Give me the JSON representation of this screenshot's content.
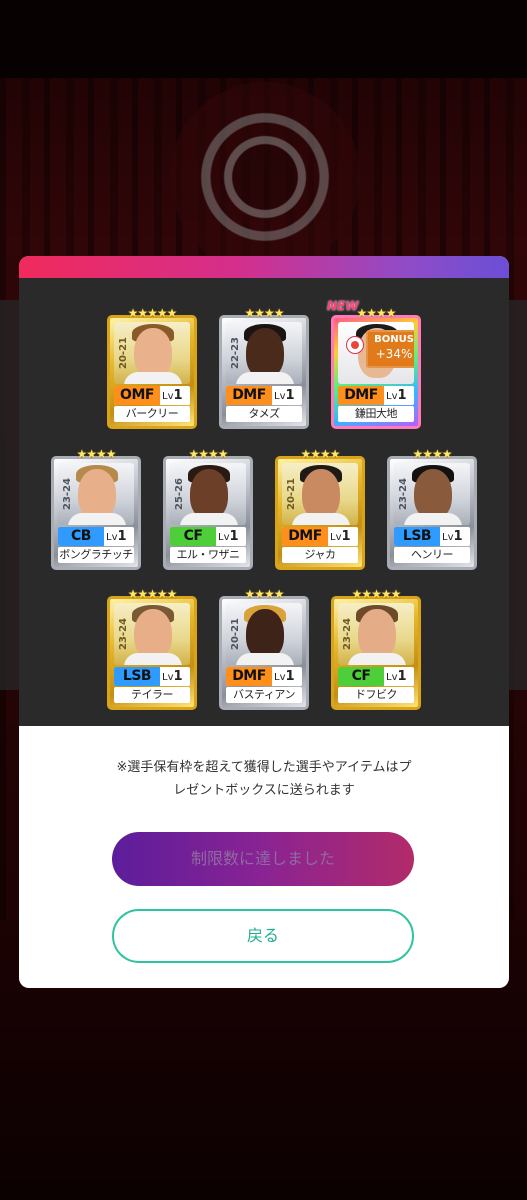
{
  "cards": [
    {
      "position": "OMF",
      "level_prefix": "Lv",
      "level": "1",
      "name": "バークリー",
      "season": "20-21",
      "stars": "★★★★★",
      "new": false
    },
    {
      "position": "DMF",
      "level_prefix": "Lv",
      "level": "1",
      "name": "タメズ",
      "season": "22-23",
      "stars": "★★★★",
      "new": false
    },
    {
      "position": "DMF",
      "level_prefix": "Lv",
      "level": "1",
      "name": "鎌田大地",
      "season": "",
      "stars": "★★★★",
      "new": true,
      "new_label": "NEW",
      "bonus_label": "BONUS",
      "bonus_value": "+34%"
    },
    {
      "position": "CB",
      "level_prefix": "Lv",
      "level": "1",
      "name": "ボングラチッチ",
      "season": "23-24",
      "stars": "★★★★",
      "new": false
    },
    {
      "position": "CF",
      "level_prefix": "Lv",
      "level": "1",
      "name": "エル・ワザニ",
      "season": "25-26",
      "stars": "★★★★",
      "new": false
    },
    {
      "position": "DMF",
      "level_prefix": "Lv",
      "level": "1",
      "name": "ジャカ",
      "season": "20-21",
      "stars": "★★★★",
      "new": false
    },
    {
      "position": "LSB",
      "level_prefix": "Lv",
      "level": "1",
      "name": "ヘンリー",
      "season": "23-24",
      "stars": "★★★★",
      "new": false
    },
    {
      "position": "LSB",
      "level_prefix": "Lv",
      "level": "1",
      "name": "テイラー",
      "season": "23-24",
      "stars": "★★★★★",
      "new": false
    },
    {
      "position": "DMF",
      "level_prefix": "Lv",
      "level": "1",
      "name": "バスティアン",
      "season": "20-21",
      "stars": "★★★★",
      "new": false
    },
    {
      "position": "CF",
      "level_prefix": "Lv",
      "level": "1",
      "name": "ドフビク",
      "season": "23-24",
      "stars": "★★★★★",
      "new": false
    }
  ],
  "notice": {
    "line1": "※選手保有枠を超えて獲得した選手やアイテムはプ",
    "line2": "レゼントボックスに送られます"
  },
  "buttons": {
    "limit_label": "制限数に達しました",
    "back_label": "戻る"
  },
  "colors": {
    "header_gradient_start": "#f02a5c",
    "header_gradient_end": "#6b4fd6",
    "back_button": "#2ec3a1",
    "limit_button_start": "#5c1d9b",
    "limit_button_end": "#b22b6a"
  }
}
